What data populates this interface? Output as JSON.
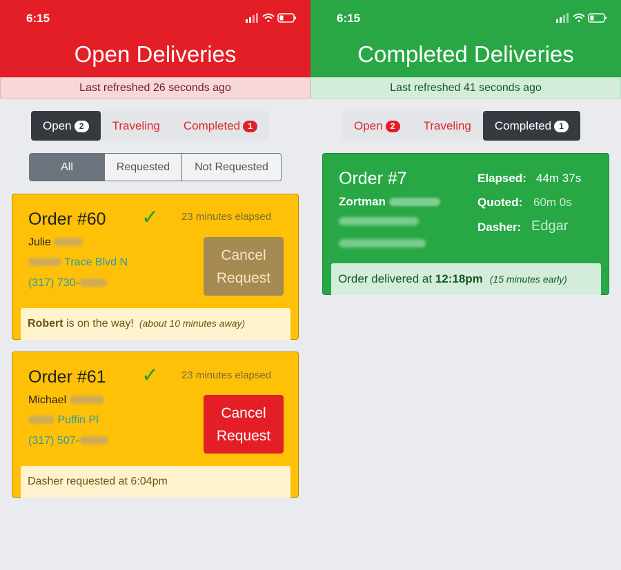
{
  "open_screen": {
    "status_time": "6:15",
    "title": "Open Deliveries",
    "refreshed": "Last refreshed 26 seconds ago",
    "tabs": [
      {
        "label": "Open",
        "badge": "2"
      },
      {
        "label": "Traveling"
      },
      {
        "label": "Completed",
        "badge": "1"
      }
    ],
    "filters": [
      "All",
      "Requested",
      "Not Requested"
    ],
    "orders": [
      {
        "title": "Order #60",
        "check": "✓",
        "elapsed": "23 minutes elapsed",
        "customer": "Julie",
        "address": "Trace Blvd N",
        "phone": "(317) 730-",
        "button_line1": "Cancel",
        "button_line2": "Request",
        "footer_bold": "Robert",
        "footer_text": " is on the way!",
        "footer_note": "(about 10 minutes away)"
      },
      {
        "title": "Order #61",
        "check": "✓",
        "elapsed": "23 minutes elapsed",
        "customer": "Michael",
        "address": "Puffin Pl",
        "phone": "(317) 507-",
        "button_line1": "Cancel",
        "button_line2": "Request",
        "footer_text": "Dasher requested at 6:04pm"
      }
    ]
  },
  "completed_screen": {
    "status_time": "6:15",
    "title": "Completed Deliveries",
    "refreshed": "Last refreshed 41 seconds ago",
    "tabs": [
      {
        "label": "Open",
        "badge": "2"
      },
      {
        "label": "Traveling"
      },
      {
        "label": "Completed",
        "badge": "1"
      }
    ],
    "order": {
      "title": "Order #7",
      "customer": "Zortman",
      "elapsed_label": "Elapsed:",
      "elapsed_value": "44m 37s",
      "quoted_label": "Quoted:",
      "quoted_value": "60m 0s",
      "dasher_label": "Dasher:",
      "dasher_value": "Edgar",
      "footer_text": "Order delivered at ",
      "footer_time": "12:18pm",
      "footer_note": "(15 minutes early)"
    }
  },
  "colors": {
    "open_header": "#e31e26",
    "completed_header": "#29a745",
    "card_warning": "#ffc107",
    "active_tab": "#343a40"
  }
}
